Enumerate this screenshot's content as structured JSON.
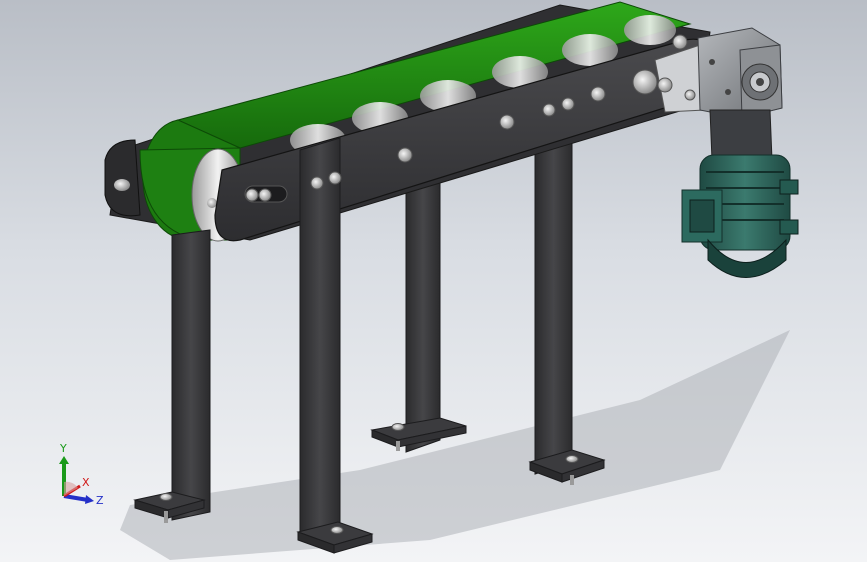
{
  "viewport": {
    "background_top": "#b9bec6",
    "background_bottom": "#f3f4f6"
  },
  "model": {
    "belt_color": "#1f8a12",
    "frame_color": "#3a3a3c",
    "motor_color": "#2a5f55",
    "gearbox_color": "#8a8d91"
  },
  "triad": {
    "x_label": "X",
    "y_label": "Y",
    "z_label": "Z",
    "x_color": "#d01818",
    "y_color": "#1a9a1a",
    "z_color": "#2430c8"
  }
}
